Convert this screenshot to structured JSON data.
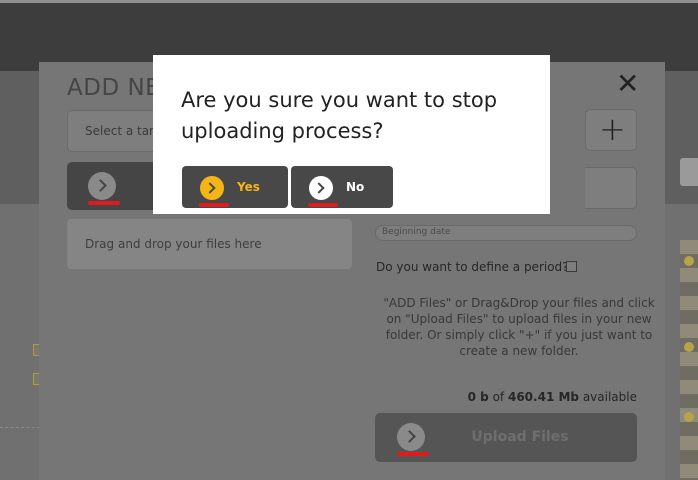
{
  "modal": {
    "title": "ADD NE",
    "close_glyph": "✕",
    "target_select_placeholder": "Select a targ",
    "dropzone_text": "Drag and drop your files here",
    "plus_glyph": "+",
    "date_placeholder": "Beginning date",
    "period_question": "Do you want to define a period?",
    "help_text": "\"ADD Files\" or Drag&Drop your files and click on \"Upload Files\" to upload files in your new folder. Or simply click \"+\" if you just want to create a new folder.",
    "usage": {
      "used": "0 b",
      "of": "of",
      "total": "460.41 Mb",
      "suffix": "available"
    },
    "upload_label": "Upload Files"
  },
  "confirm": {
    "question": "Are you sure you want to stop uploading process?",
    "yes_label": "Yes",
    "no_label": "No"
  },
  "colors": {
    "yes_accent": "#f5b517",
    "highlight_line": "#e21a1a",
    "button_dark": "#484848"
  }
}
